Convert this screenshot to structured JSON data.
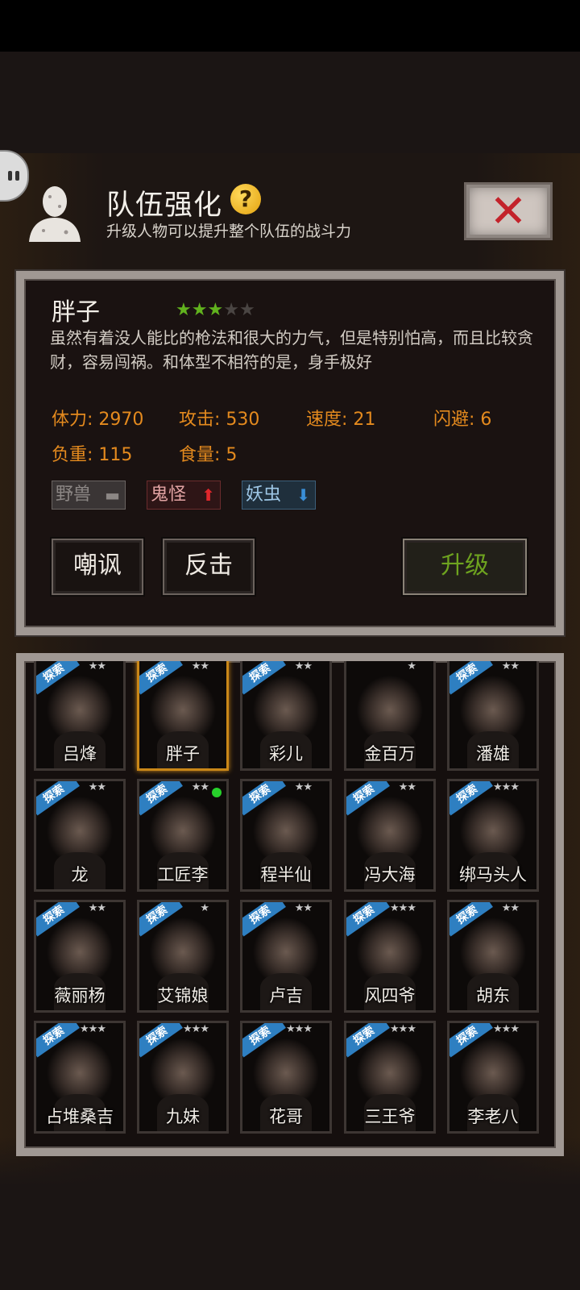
{
  "header": {
    "title": "队伍强化",
    "help_icon": "question-icon",
    "subtitle": "升级人物可以提升整个队伍的战斗力",
    "close_icon": "close-icon"
  },
  "character": {
    "name": "胖子",
    "stars_filled": 3,
    "stars_total": 5,
    "description": "虽然有着没人能比的枪法和很大的力气，但是特别怕高，而且比较贪财，容易闯祸。和体型不相符的是，身手极好",
    "stats": {
      "hp": "体力: 2970",
      "attack": "攻击: 530",
      "speed": "速度: 21",
      "dodge": "闪避: 6",
      "load": "负重: 115",
      "food": "食量: 5"
    },
    "tags": {
      "beast": "野兽",
      "ghost": "鬼怪",
      "bug": "妖虫"
    }
  },
  "actions": {
    "taunt": "嘲讽",
    "counter": "反击",
    "upgrade": "升级"
  },
  "roster": {
    "explore_badge": "探索",
    "names": [
      "吕烽",
      "胖子",
      "彩儿",
      "金百万",
      "潘雄",
      "龙",
      "工匠李",
      "程半仙",
      "冯大海",
      "绑马头人",
      "薇丽杨",
      "艾锦娘",
      "卢吉",
      "风四爷",
      "胡东",
      "占堆桑吉",
      "九妹",
      "花哥",
      "三王爷",
      "李老八"
    ]
  },
  "colors": {
    "stat_orange": "#e48a1e",
    "upgrade_green": "#6ea31f",
    "selected_gold": "#c98718",
    "star_green": "#61b21e"
  }
}
